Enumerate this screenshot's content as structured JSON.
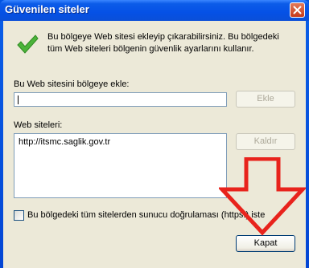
{
  "window": {
    "title": "Güvenilen siteler"
  },
  "message": "Bu bölgeye Web sitesi ekleyip çıkarabilirsiniz. Bu bölgedeki tüm Web siteleri bölgenin güvenlik ayarlarını kullanır.",
  "add_section": {
    "label": "Bu Web sitesini bölgeye ekle:",
    "input_value": "",
    "add_button": "Ekle"
  },
  "sites_section": {
    "label": "Web siteleri:",
    "items": [
      "http://itsmc.saglik.gov.tr"
    ],
    "remove_button": "Kaldır"
  },
  "https_checkbox": {
    "label": "Bu bölgedeki tüm sitelerden sunucu doğrulaması (https:) iste",
    "checked": false
  },
  "close_button": "Kapat",
  "colors": {
    "titlebar": "#0054e3",
    "dialog_bg": "#ece9d8",
    "annotation_arrow": "#e8231c",
    "check_green": "#4bb33a"
  },
  "icons": {
    "status": "green-checkmark-icon",
    "close": "close-icon",
    "annotation": "red-arrow-down"
  }
}
